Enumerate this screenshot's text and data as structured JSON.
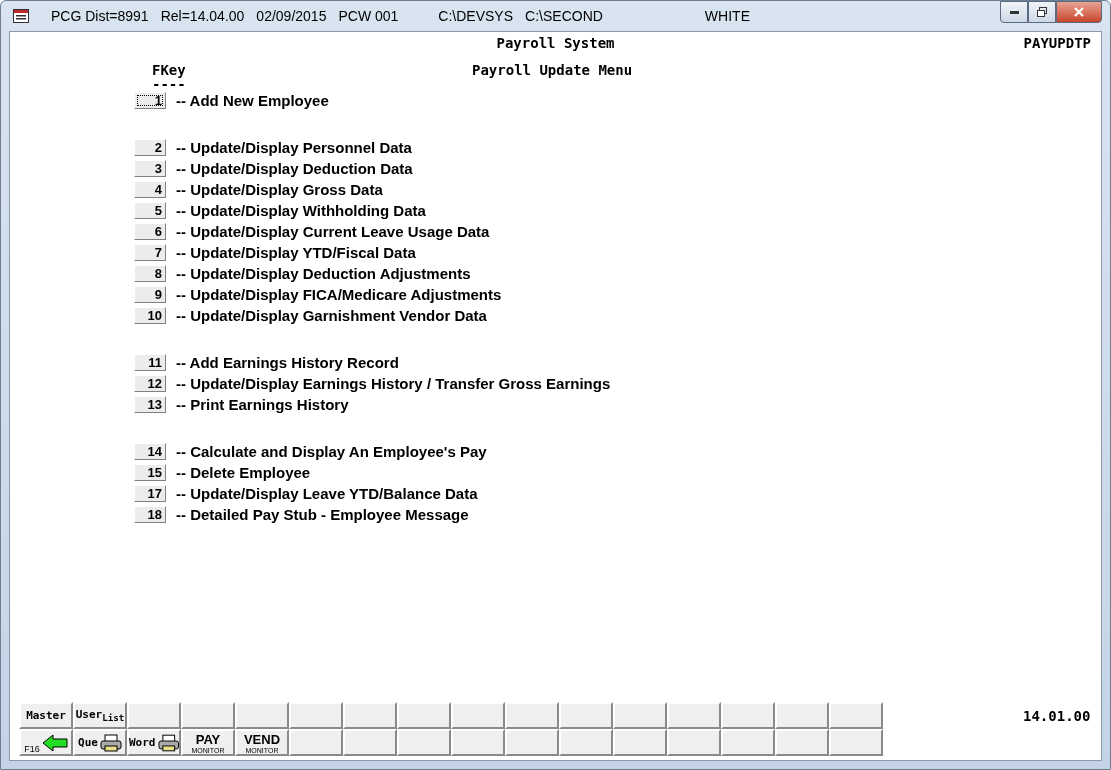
{
  "window": {
    "title_parts": [
      "PCG Dist=8991",
      "Rel=14.04.00",
      "02/09/2015",
      "PCW 001",
      "C:\\DEVSYS",
      "C:\\SECOND",
      "WHITE"
    ]
  },
  "header": {
    "title": "Payroll System",
    "screen_id": "PAYUPDTP"
  },
  "menu": {
    "column_label": "FKey",
    "column_rule": "----",
    "title": "Payroll Update Menu",
    "groups": [
      [
        {
          "key": "1",
          "text": "-- Add New Employee",
          "focused": true
        }
      ],
      [
        {
          "key": "2",
          "text": "-- Update/Display Personnel Data",
          "focused": false
        },
        {
          "key": "3",
          "text": "-- Update/Display Deduction Data",
          "focused": false
        },
        {
          "key": "4",
          "text": "-- Update/Display Gross Data",
          "focused": false
        },
        {
          "key": "5",
          "text": "-- Update/Display Withholding Data",
          "focused": false
        },
        {
          "key": "6",
          "text": "-- Update/Display Current Leave Usage Data",
          "focused": false
        },
        {
          "key": "7",
          "text": "-- Update/Display YTD/Fiscal Data",
          "focused": false
        },
        {
          "key": "8",
          "text": "-- Update/Display Deduction Adjustments",
          "focused": false
        },
        {
          "key": "9",
          "text": "-- Update/Display FICA/Medicare Adjustments",
          "focused": false
        },
        {
          "key": "10",
          "text": "-- Update/Display Garnishment Vendor Data",
          "focused": false
        }
      ],
      [
        {
          "key": "11",
          "text": "-- Add Earnings History Record",
          "focused": false
        },
        {
          "key": "12",
          "text": "-- Update/Display Earnings History / Transfer Gross Earnings",
          "focused": false
        },
        {
          "key": "13",
          "text": "-- Print Earnings History",
          "focused": false
        }
      ],
      [
        {
          "key": "14",
          "text": "-- Calculate and Display An Employee's Pay",
          "focused": false
        },
        {
          "key": "15",
          "text": "-- Delete Employee",
          "focused": false
        },
        {
          "key": "17",
          "text": "-- Update/Display Leave YTD/Balance Data",
          "focused": false
        },
        {
          "key": "18",
          "text": "-- Detailed Pay Stub - Employee Message",
          "focused": false
        }
      ]
    ]
  },
  "function_keys": {
    "rows": [
      [
        {
          "kind": "text",
          "label": "Master"
        },
        {
          "kind": "text",
          "label": "User$_{List}$"
        },
        {
          "kind": "empty"
        },
        {
          "kind": "empty"
        },
        {
          "kind": "empty"
        },
        {
          "kind": "empty"
        },
        {
          "kind": "empty"
        },
        {
          "kind": "empty"
        },
        {
          "kind": "empty"
        },
        {
          "kind": "empty"
        },
        {
          "kind": "empty"
        },
        {
          "kind": "empty"
        },
        {
          "kind": "empty"
        },
        {
          "kind": "empty"
        },
        {
          "kind": "empty"
        },
        {
          "kind": "empty"
        }
      ],
      [
        {
          "kind": "back",
          "label": "F16"
        },
        {
          "kind": "printer",
          "label": "Que"
        },
        {
          "kind": "printer",
          "label": "Word"
        },
        {
          "kind": "monitor",
          "label": "PAY",
          "sublabel": "MONITOR"
        },
        {
          "kind": "monitor",
          "label": "VEND",
          "sublabel": "MONITOR"
        },
        {
          "kind": "empty"
        },
        {
          "kind": "empty"
        },
        {
          "kind": "empty"
        },
        {
          "kind": "empty"
        },
        {
          "kind": "empty"
        },
        {
          "kind": "empty"
        },
        {
          "kind": "empty"
        },
        {
          "kind": "empty"
        },
        {
          "kind": "empty"
        },
        {
          "kind": "empty"
        },
        {
          "kind": "empty"
        }
      ]
    ],
    "version": "14.01.00"
  }
}
